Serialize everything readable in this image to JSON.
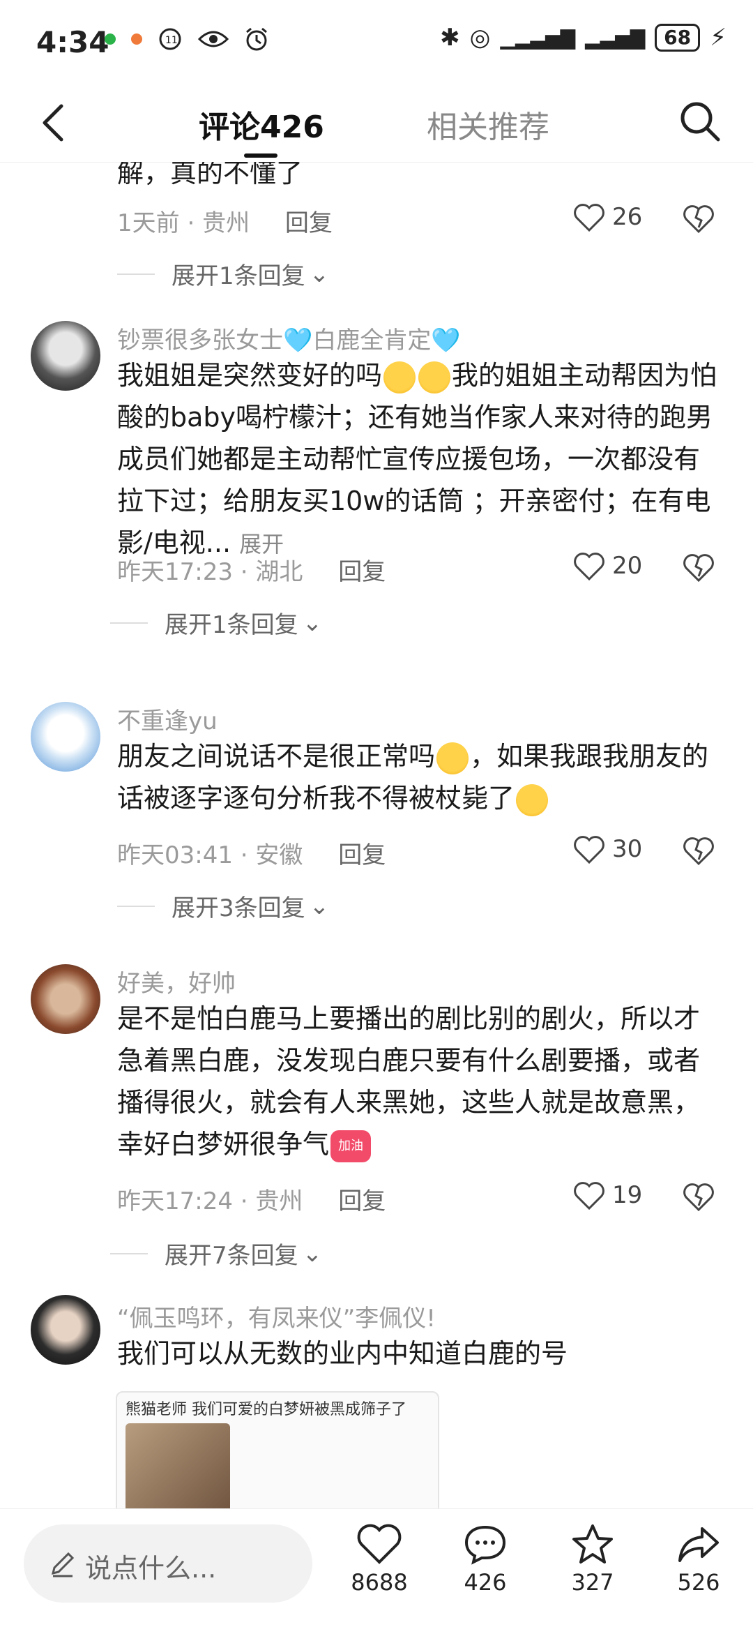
{
  "status": {
    "time": "4:34",
    "battery": "68"
  },
  "header": {
    "tab_comments": "评论426",
    "tab_related": "相关推荐"
  },
  "comments": [
    {
      "username": "",
      "text": "解，真的不懂了",
      "time": "1天前",
      "location": "贵州",
      "reply_label": "回复",
      "likes": "26",
      "expand": "展开1条回复"
    },
    {
      "username": "钞票很多张女士🩵白鹿全肯定🩵",
      "text_parts": [
        "我姐姐是突然变好的吗",
        "我的姐姐主动帮因为怕酸的baby喝柠檬汁；还有她当作家人来对待的跑男成员们她都是主动帮忙宣传应援包场，一次都没有拉下过；给朋友买10w的话筒 ；开亲密付；在有电影/电视..."
      ],
      "more": "展开",
      "time": "昨天17:23",
      "location": "湖北",
      "reply_label": "回复",
      "likes": "20",
      "expand": "展开1条回复"
    },
    {
      "username": "不重逢yu",
      "text_parts": [
        "朋友之间说话不是很正常吗",
        "，如果我跟我朋友的话被逐字逐句分析我不得被杖毙了"
      ],
      "time": "昨天03:41",
      "location": "安徽",
      "reply_label": "回复",
      "likes": "30",
      "expand": "展开3条回复"
    },
    {
      "username": "好美，好帅",
      "text": "是不是怕白鹿马上要播出的剧比别的剧火，所以才急着黑白鹿，没发现白鹿只要有什么剧要播，或者播得很火，就会有人来黑她，这些人就是故意黑，幸好白梦妍很争气",
      "emoji_text": "加油",
      "time": "昨天17:24",
      "location": "贵州",
      "reply_label": "回复",
      "likes": "19",
      "expand": "展开7条回复"
    },
    {
      "username": "“佩玉鸣环，有凤来仪”李佩仪!",
      "text": "我们可以从无数的业内中知道白鹿的号",
      "card_title": "熊猫老师 我们可爱的白梦妍被黑成筛子了"
    }
  ],
  "bottom": {
    "input_placeholder": "说点什么...",
    "likes": "8688",
    "comments": "426",
    "favorites": "327",
    "shares": "526"
  }
}
